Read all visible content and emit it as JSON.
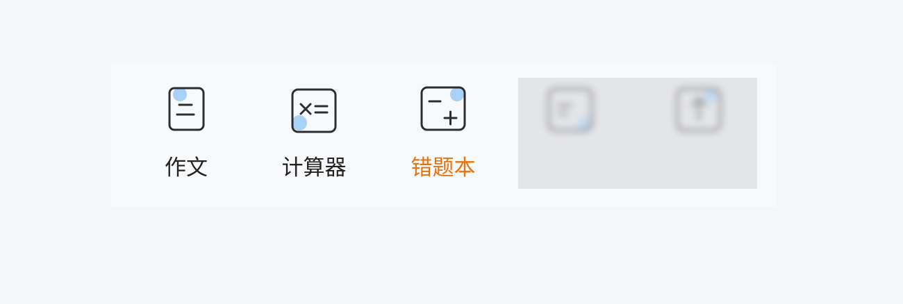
{
  "toolbar": {
    "items": [
      {
        "label": "作文",
        "icon": "essay-icon"
      },
      {
        "label": "计算器",
        "icon": "calculator-icon"
      },
      {
        "label": "错题本",
        "icon": "mistake-book-icon"
      },
      {
        "label": "",
        "icon": "blurred-tool-icon"
      },
      {
        "label": "",
        "icon": "download-icon"
      }
    ]
  },
  "colors": {
    "background": "#f5f6f8",
    "icon_stroke": "#2b2d33",
    "icon_accent": "#a9d0f5",
    "active_label": "#e8730c",
    "label": "#222222"
  }
}
